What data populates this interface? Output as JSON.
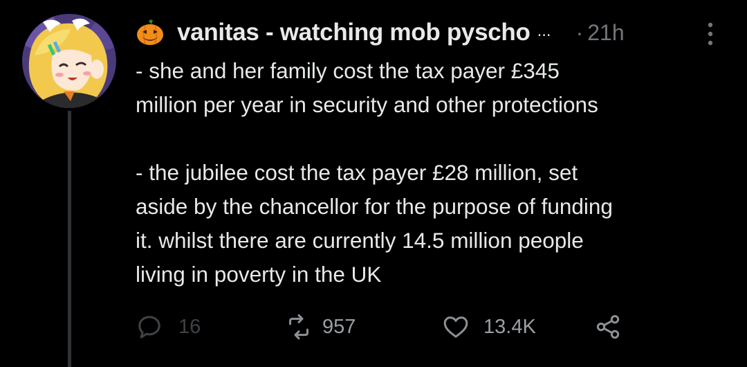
{
  "tweet": {
    "avatar_icon": "anime-character-avatar",
    "name_emoji": "jack-o-lantern-icon",
    "display_name": "vanitas - watching mob pyscho",
    "truncation": "...",
    "separator": "·",
    "timestamp": "21h",
    "more_icon": "vertical-ellipsis-icon",
    "text": "- she and her family cost the tax payer £345\nmillion per year in security and other protections\n\n- the jubilee cost the tax payer £28 million, set\naside by the chancellor for the purpose of funding\nit. whilst there are currently 14.5 million people\nliving in poverty in the UK"
  },
  "actions": {
    "reply": {
      "icon": "reply-bubble-icon",
      "count": "16"
    },
    "retweet": {
      "icon": "retweet-icon",
      "count": "957"
    },
    "like": {
      "icon": "heart-icon",
      "count": "13.4K"
    },
    "share": {
      "icon": "share-icon"
    }
  },
  "colors": {
    "background": "#000000",
    "text_primary": "#e7e9ea",
    "text_secondary": "#71767b",
    "thread_line": "#2f3336"
  }
}
